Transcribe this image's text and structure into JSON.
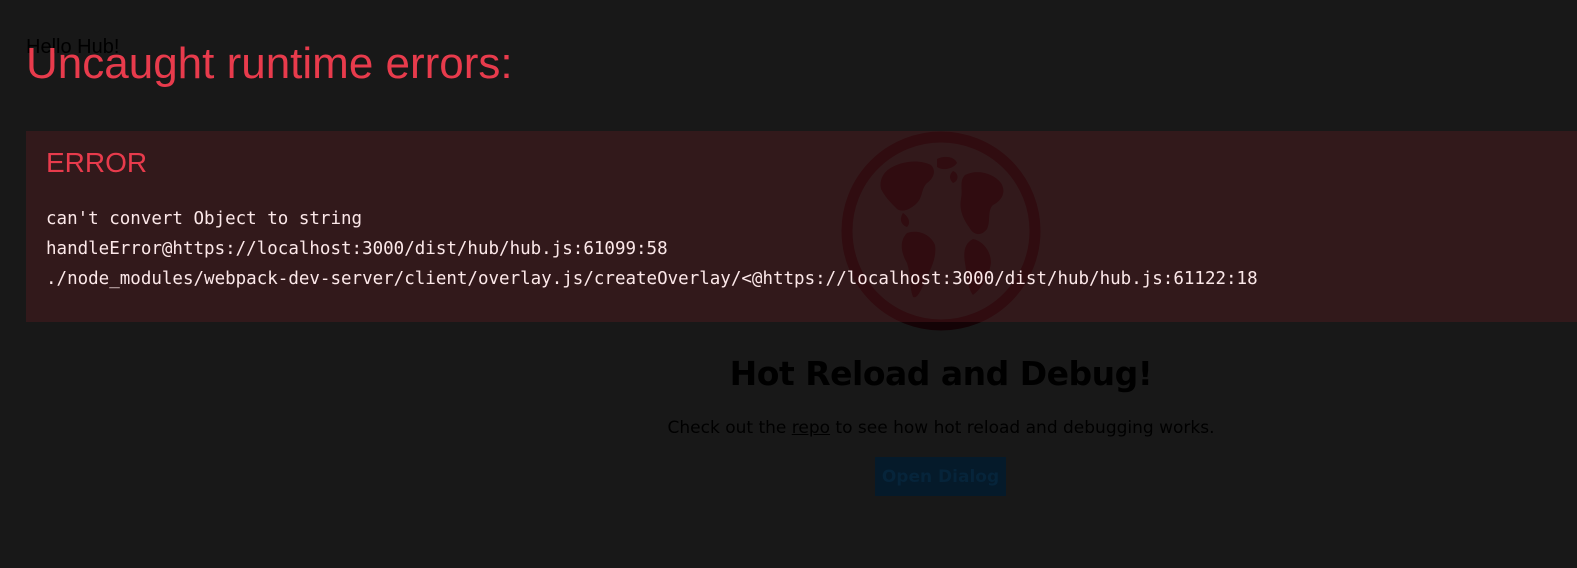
{
  "page": {
    "hello_text": "Hello Hub!",
    "hero_title": "Hot Reload and Debug!",
    "hero_text_before": "Check out the ",
    "hero_link": "repo",
    "hero_text_after": " to see how hot reload and debugging works.",
    "button_label": "Open Dialog",
    "icon": "globe-icon"
  },
  "overlay": {
    "title": "Uncaught runtime errors:",
    "error_label": "ERROR",
    "stack": [
      "can't convert Object to string",
      "handleError@https://localhost:3000/dist/hub/hub.js:61099:58",
      "./node_modules/webpack-dev-server/client/overlay.js/createOverlay/<@https://localhost:3000/dist/hub/hub.js:61122:18"
    ]
  },
  "colors": {
    "accent_error": "#e83b4c",
    "background": "#1a1a1a",
    "stack_text": "#fce8e9"
  }
}
